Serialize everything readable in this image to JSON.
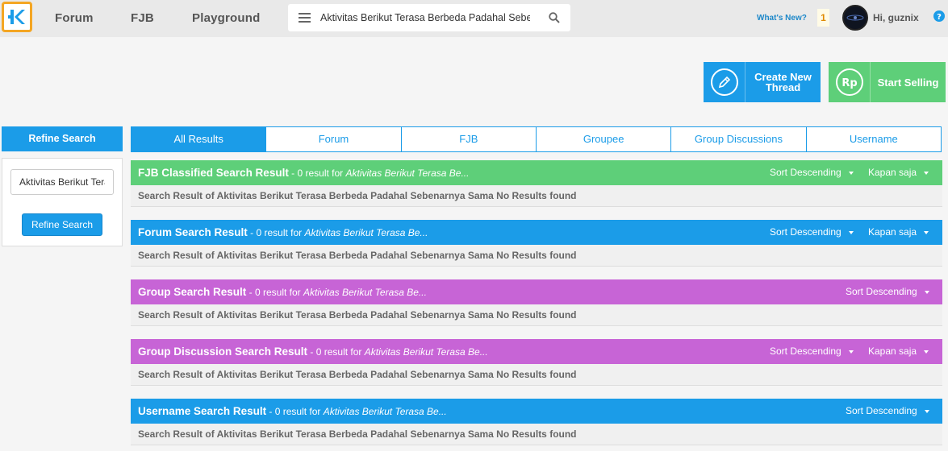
{
  "nav": {
    "links": [
      "Forum",
      "FJB",
      "Playground"
    ],
    "search_value": "Aktivitas Berikut Terasa Berbeda Padahal Sebenarnya Sama",
    "whats_new": "What's New?",
    "notification_count": "1",
    "greeting": "Hi, guznix"
  },
  "actions": {
    "create_thread": "Create New Thread",
    "start_selling": "Start Selling"
  },
  "sidebar": {
    "title": "Refine Search",
    "query_value": "Aktivitas Berikut Terasa Berbeda Padahal Sebenarnya Sama",
    "button": "Refine Search"
  },
  "tabs": [
    "All Results",
    "Forum",
    "FJB",
    "Groupee",
    "Group Discussions",
    "Username"
  ],
  "sections": [
    {
      "title": "FJB Classified Search Result",
      "meta": " - 0 result for ",
      "query": "Aktivitas Berikut Terasa Be...",
      "sort": "Sort Descending",
      "time": "Kapan saja",
      "body": "Search Result of Aktivitas Berikut Terasa Berbeda Padahal Sebenarnya Sama No Results found"
    },
    {
      "title": "Forum Search Result",
      "meta": " - 0 result for ",
      "query": "Aktivitas Berikut Terasa Be...",
      "sort": "Sort Descending",
      "time": "Kapan saja",
      "body": "Search Result of Aktivitas Berikut Terasa Berbeda Padahal Sebenarnya Sama No Results found"
    },
    {
      "title": "Group Search Result",
      "meta": " - 0 result for ",
      "query": "Aktivitas Berikut Terasa Be...",
      "sort": "Sort Descending",
      "body": "Search Result of Aktivitas Berikut Terasa Berbeda Padahal Sebenarnya Sama No Results found"
    },
    {
      "title": "Group Discussion Search Result",
      "meta": " - 0 result for ",
      "query": "Aktivitas Berikut Terasa Be...",
      "sort": "Sort Descending",
      "time": "Kapan saja",
      "body": "Search Result of Aktivitas Berikut Terasa Berbeda Padahal Sebenarnya Sama No Results found"
    },
    {
      "title": "Username Search Result",
      "meta": " - 0 result for ",
      "query": "Aktivitas Berikut Terasa Be...",
      "sort": "Sort Descending",
      "body": "Search Result of Aktivitas Berikut Terasa Berbeda Padahal Sebenarnya Sama No Results found"
    }
  ],
  "colors": {
    "blue": "#1b9ce8",
    "green": "#5ecf79",
    "purple": "#c764d6",
    "logo_border": "#f4a623"
  },
  "icons": {
    "logo": "kaskus-logo-icon",
    "menu": "hamburger-menu-icon",
    "search": "search-icon",
    "create": "pencil-icon",
    "sell": "rupiah-icon",
    "help": "help-icon"
  }
}
